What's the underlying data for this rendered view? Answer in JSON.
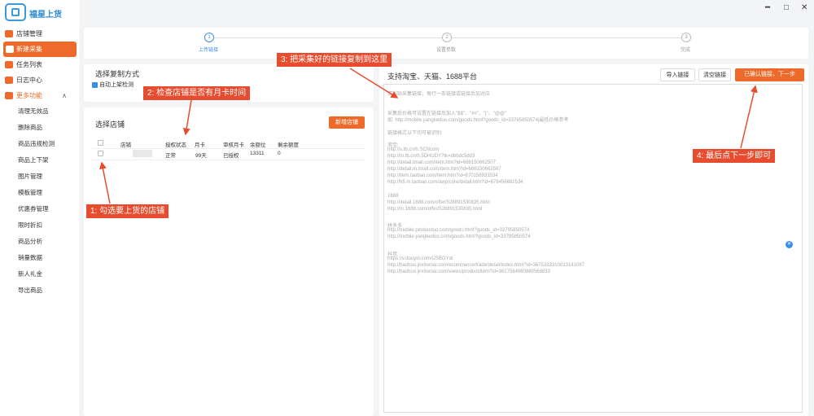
{
  "app": {
    "name": "福星上货"
  },
  "window_controls": {
    "minimize": "━",
    "maximize": "□",
    "close": "✕"
  },
  "sidebar": {
    "items": [
      {
        "label": "店铺管理",
        "icon": "store-icon"
      },
      {
        "label": "新建采集",
        "icon": "collect-icon",
        "active": true
      },
      {
        "label": "任务列表",
        "icon": "task-list-icon"
      },
      {
        "label": "日志中心",
        "icon": "log-icon"
      },
      {
        "label": "更多功能",
        "icon": "more-icon",
        "expanded_caret": "∧"
      }
    ],
    "sub_items": [
      "清理无效品",
      "删除商品",
      "商品违规检测",
      "商品上下架",
      "图片管理",
      "模板管理",
      "优惠券管理",
      "限时折扣",
      "商品分析",
      "销量数据",
      "新人礼金",
      "导出商品"
    ]
  },
  "steps": [
    {
      "num": "1",
      "label": "上传链接",
      "active": true
    },
    {
      "num": "2",
      "label": "设置参数",
      "active": false
    },
    {
      "num": "3",
      "label": "完成",
      "active": false
    }
  ],
  "collect_method": {
    "title": "选择复制方式",
    "auto_check_label": "自动上架检测",
    "auto_check": true
  },
  "store_panel": {
    "title": "选择店铺",
    "add_button": "新增店铺",
    "columns": [
      "店铺",
      "授权状态",
      "月卡",
      "审核月卡",
      "余额位",
      "剩余额度"
    ],
    "rows": [
      {
        "store": "",
        "auth": "正常",
        "card": "99天",
        "review_card": "已授权",
        "balance": "13311",
        "remaining": "0"
      }
    ]
  },
  "links_panel": {
    "title": "支持淘宝、天猫、1688平台",
    "import_button": "导入链接",
    "clear_button": "清空链接",
    "next_button": "已确认链接，下一步",
    "placeholder_lines": [
      "请粘贴采集链接，每行一条链接或链接后加对应",
      "",
      "采集后价格可设置在链接后加入\"$$\"、\"##\"、\"|\"、\"@@\"",
      "如: http://mobile.yangkeduo.com/goods.html?goods_id=33795850574|最低价格参考",
      "",
      "链接格式以下均可被识别:",
      "",
      "淘宝:",
      "http://s.tb.cn/h.SCNcom",
      "http://m.tb.cn/h.5DHUDY?tk=dbbdc5dd3",
      "http://detail.tmall.com/item.htm?id=688150662507",
      "http://detail.m.tmall.com/item.htm?id=688150662507",
      "http://item.taobao.com/item.htm?id=670158933534",
      "http://h5.m.taobao.com/awp/core/detail.htm?id=678456682534",
      "",
      "1688:",
      "http://detail.1688.com/offer/528891530835.html",
      "http://m.1688.com/offer/528891530835.html",
      "",
      "拼多多:",
      "http://mobile.pinduoduo.com/goods.html?goods_id=33795850574",
      "http://mobile.yangkeduo.com/goods.html?goods_id=33795850574",
      "",
      "抖音:",
      "https://v.douyin.com/iJSBGYd/",
      "http://haohuo.jinritemai.com/ecommerce/trade/detail/index.html?id=3675333310013141087",
      "http://haohuo.jinritemai.com/views/product/item?id=3617584960880568833"
    ]
  },
  "callouts": [
    {
      "text": "1: 勾选要上货的店铺"
    },
    {
      "text": "2: 检查店铺是否有月卡时间"
    },
    {
      "text": "3: 把采集好的链接复制到这里"
    },
    {
      "text": "4: 最后点下一步即可"
    }
  ],
  "colors": {
    "accent": "#ee6a2a",
    "primary": "#3a8ee6",
    "callout": "#e74c2e"
  }
}
